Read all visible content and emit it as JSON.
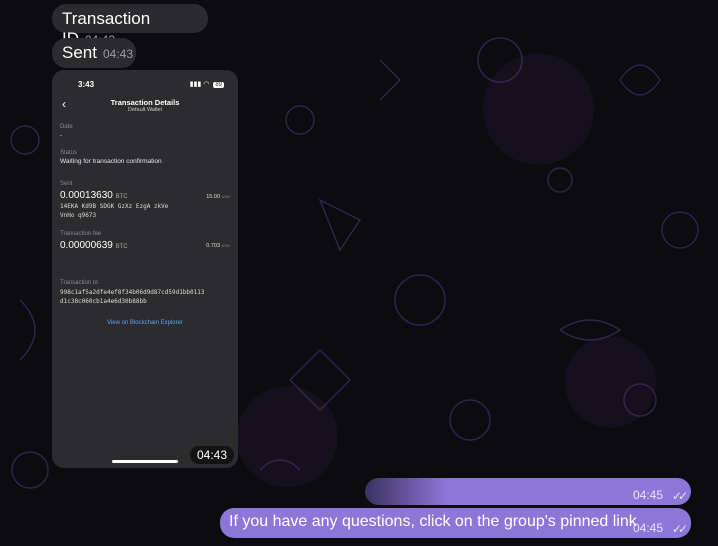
{
  "messages": {
    "m1": {
      "text": "Transaction ID",
      "time": "04:43"
    },
    "m2": {
      "text": "Sent",
      "time": "04:43"
    },
    "photo": {
      "time": "04:43",
      "phone": {
        "clock": "3:43",
        "battery": "89",
        "title": "Transaction Details",
        "subtitle": "Default Wallet",
        "date_label": "Date",
        "date_value": "-",
        "status_label": "Status",
        "status_value": "Waiting for transaction confirmation",
        "sent_label": "Sent",
        "sent_amount": "0.00013630",
        "sent_unit": "BTC",
        "sent_fiat": "15.00",
        "sent_fiat_cur": "USD",
        "address_line1": "14EKA Kd9B SDGK GzXz EzgA zkVe",
        "address_line2": "VnHo q9673",
        "fee_label": "Transaction fee",
        "fee_amount": "0.00000639",
        "fee_unit": "BTC",
        "fee_fiat": "0.703",
        "fee_fiat_cur": "USD",
        "txid_label": "Transaction Id",
        "txid_line1": "998c1af5a2dfe4ef8f34b06d9d87cd59d1bb0113",
        "txid_line2": "d1c38c060cb1a4e6d30b88bb",
        "explorer_link": "View on Blockchain Explorer"
      }
    },
    "out1": {
      "time": "04:45",
      "ticks": "✓✓"
    },
    "out2": {
      "text": "If you have any questions, click on the group's pinned link",
      "time": "04:45",
      "ticks": "✓✓"
    }
  },
  "colors": {
    "outgoing_bubble": "#8b77d8",
    "incoming_bubble": "#2b2b2e",
    "pattern": "#5a3c8c"
  }
}
